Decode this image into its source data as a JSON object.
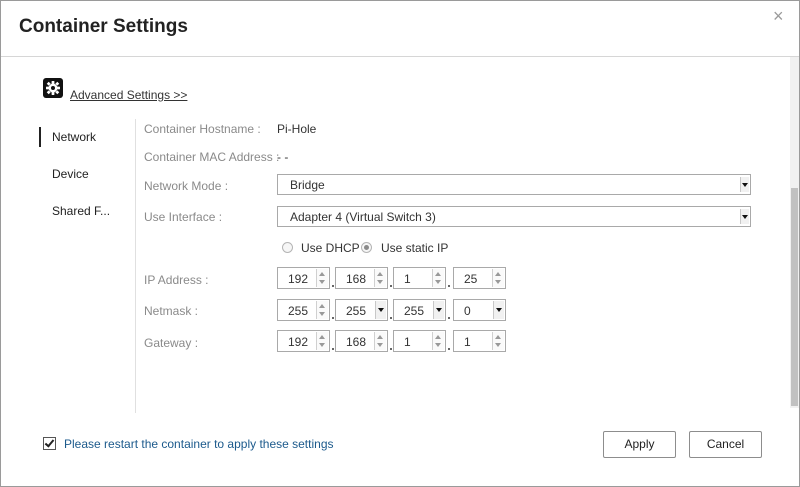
{
  "dialog": {
    "title": "Container Settings",
    "close_icon": "×"
  },
  "advanced": {
    "icon": "gear-icon",
    "link": "Advanced Settings >>"
  },
  "sidebar": {
    "items": [
      {
        "label": "Network",
        "active": true
      },
      {
        "label": "Device",
        "active": false
      },
      {
        "label": "Shared F..."
      }
    ]
  },
  "network": {
    "hostname_label": "Container Hostname :",
    "hostname_value": "Pi-Hole",
    "mac_label": "Container MAC Address :",
    "mac_value": "- -",
    "mode_label": "Network Mode :",
    "mode_value": "Bridge",
    "interface_label": "Use Interface :",
    "interface_value": "Adapter 4 (Virtual Switch 3)",
    "dhcp_label": "Use DHCP",
    "static_label": "Use static IP",
    "ip_label": "IP Address :",
    "ip": [
      "192",
      "168",
      "1",
      "25"
    ],
    "netmask_label": "Netmask :",
    "netmask": [
      "255",
      "255",
      "255",
      "0"
    ],
    "gateway_label": "Gateway :",
    "gateway": [
      "192",
      "168",
      "1",
      "1"
    ]
  },
  "footer": {
    "restart_text": "Please restart the container to apply these settings",
    "apply_label": "Apply",
    "cancel_label": "Cancel"
  },
  "colors": {
    "link_blue": "#1c5a8c"
  }
}
